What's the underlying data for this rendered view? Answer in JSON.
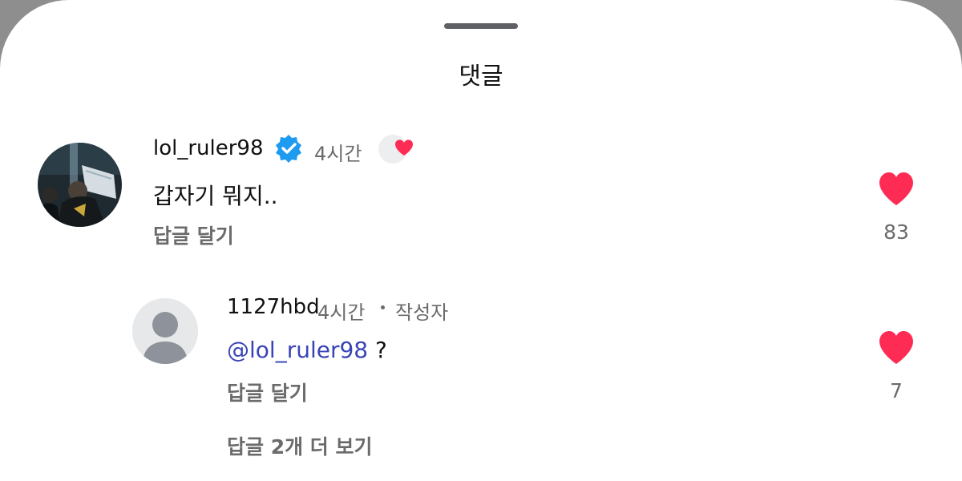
{
  "sheet": {
    "title": "댓글"
  },
  "comments": [
    {
      "username": "lol_ruler98",
      "verified": true,
      "time": "4시간",
      "creator_liked": true,
      "text": "갑자기 뭐지..",
      "reply_label": "답글 달기",
      "likes": "83",
      "avatar_icon": "profile-photo-icon"
    }
  ],
  "replies": [
    {
      "username": "1127hbd",
      "time": "4시간",
      "author_label": "작성자",
      "mention": "@lol_ruler98",
      "text_after": " ?",
      "reply_label": "답글 달기",
      "likes": "7",
      "avatar_icon": "default-avatar-icon"
    }
  ],
  "more_replies_label": "답글 2개 더 보기",
  "colors": {
    "heart": "#fe2c55",
    "verified": "#1d9bf0",
    "mention": "#3a44b8"
  }
}
